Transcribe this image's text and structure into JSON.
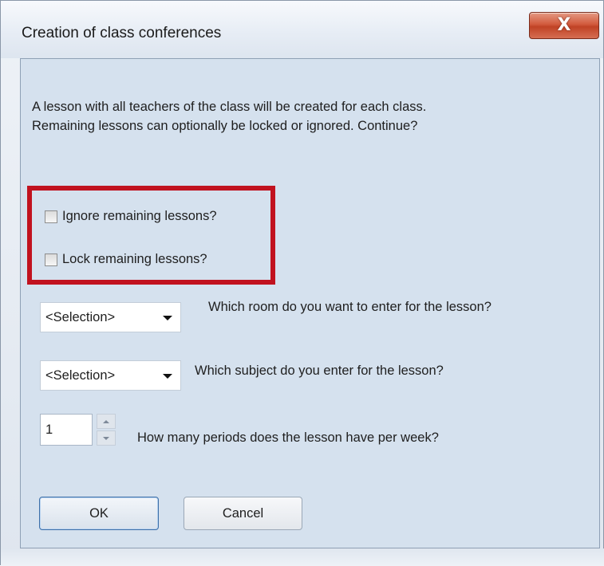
{
  "window": {
    "title": "Creation of class conferences",
    "close_label": "X"
  },
  "dialog": {
    "intro_line1": "A lesson with all teachers of the class will be created for each class.",
    "intro_line2": "Remaining lessons can optionally be locked or ignored. Continue?",
    "checkboxes": [
      {
        "label": "Ignore remaining lessons?",
        "checked": false
      },
      {
        "label": "Lock remaining lessons?",
        "checked": false
      }
    ],
    "room_select": {
      "value": "<Selection>",
      "question": "Which room do you want to enter for the lesson?"
    },
    "subject_select": {
      "value": "<Selection>",
      "question": "Which subject do you enter for the lesson?"
    },
    "periods": {
      "value": "1",
      "question": "How many periods does the lesson have per week?"
    },
    "ok_label": "OK",
    "cancel_label": "Cancel"
  },
  "colors": {
    "highlight": "#c1121f",
    "client_bg": "#d5e1ee",
    "close_button": "#c94a2e"
  },
  "icons": [
    "close-icon",
    "chevron-down-icon",
    "arrow-up-icon",
    "arrow-down-icon"
  ]
}
